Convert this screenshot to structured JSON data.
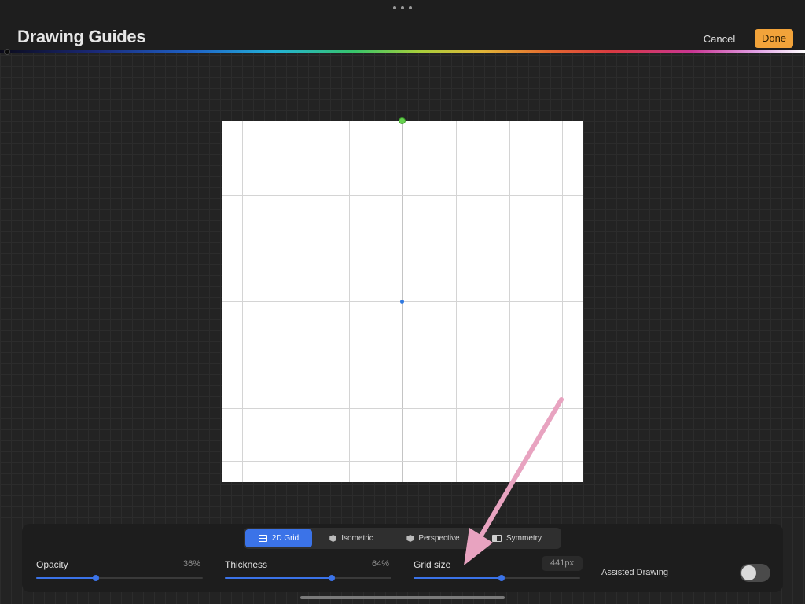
{
  "header": {
    "title": "Drawing Guides",
    "cancel_label": "Cancel",
    "done_label": "Done"
  },
  "guide_tabs": [
    {
      "label": "2D Grid",
      "icon": "grid-icon",
      "active": true
    },
    {
      "label": "Isometric",
      "icon": "hexagon-icon",
      "active": false
    },
    {
      "label": "Perspective",
      "icon": "hexagon-icon",
      "active": false
    },
    {
      "label": "Symmetry",
      "icon": "symmetry-icon",
      "active": false
    }
  ],
  "sliders": {
    "opacity": {
      "label": "Opacity",
      "value": "36%",
      "fraction": 0.36
    },
    "thickness": {
      "label": "Thickness",
      "value": "64%",
      "fraction": 0.64
    },
    "grid_size": {
      "label": "Grid size",
      "value": "441px",
      "fraction": 0.53
    }
  },
  "assisted_drawing": {
    "label": "Assisted Drawing",
    "on": false
  },
  "colors": {
    "accent": "#3b73e8",
    "done": "#f2a33a",
    "annotation_arrow": "#e8a3c0",
    "top_handle": "#66d24f"
  }
}
